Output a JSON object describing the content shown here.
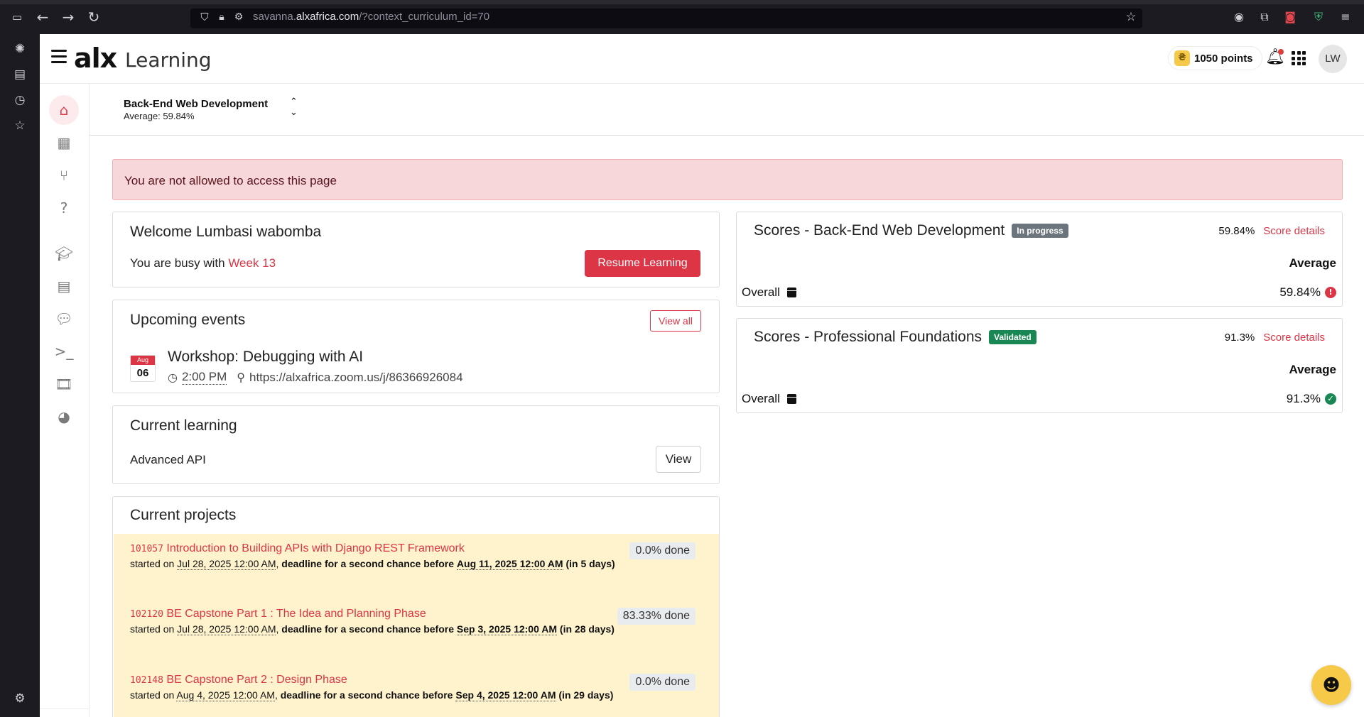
{
  "browser": {
    "url_prefix": "savanna.",
    "url_domain": "alxafrica.com",
    "url_path": "/?context_curriculum_id=70"
  },
  "header": {
    "logo": "alx",
    "product": "Learning",
    "points": "1050 points",
    "avatar_initials": "LW"
  },
  "curriculum": {
    "title": "Back-End Web Development",
    "average": "Average: 59.84%"
  },
  "alert": "You are not allowed to access this page",
  "welcome": {
    "title": "Welcome Lumbasi wabomba",
    "busy_prefix": "You are busy with",
    "busy_week": "Week 13",
    "resume_label": "Resume Learning"
  },
  "events": {
    "title": "Upcoming events",
    "view_all": "View all",
    "items": [
      {
        "month": "Aug",
        "day": "06",
        "name": "Workshop: Debugging with AI",
        "time": "2:00 PM",
        "location": "https://alxafrica.zoom.us/j/86366926084"
      }
    ]
  },
  "current_learning": {
    "title": "Current learning",
    "item": "Advanced API",
    "view_label": "View"
  },
  "projects": {
    "title": "Current projects",
    "items": [
      {
        "id": "101057",
        "name": "Introduction to Building APIs with Django REST Framework",
        "started_label": "started on",
        "started": "Jul 28, 2025 12:00 AM",
        "deadline_label": "deadline for a second chance before",
        "deadline": "Aug 11, 2025 12:00 AM",
        "remaining": "(in 5 days)",
        "done": "0.0% done"
      },
      {
        "id": "102120",
        "name": "BE Capstone Part 1 : The Idea and Planning Phase",
        "started_label": "started on",
        "started": "Jul 28, 2025 12:00 AM",
        "deadline_label": "deadline for a second chance before",
        "deadline": "Sep 3, 2025 12:00 AM",
        "remaining": "(in 28 days)",
        "done": "83.33% done"
      },
      {
        "id": "102148",
        "name": "BE Capstone Part 2 : Design Phase",
        "started_label": "started on",
        "started": "Aug 4, 2025 12:00 AM",
        "deadline_label": "deadline for a second chance before",
        "deadline": "Sep 4, 2025 12:00 AM",
        "remaining": "(in 29 days)",
        "done": "0.0% done"
      }
    ]
  },
  "scores": [
    {
      "title": "Scores - Back-End Web Development",
      "badge": "In progress",
      "percent": "59.84%",
      "details_label": "Score details",
      "avg_label": "Average",
      "overall_label": "Overall",
      "overall_value": "59.84%",
      "status": "!"
    },
    {
      "title": "Scores - Professional Foundations",
      "badge": "Validated",
      "percent": "91.3%",
      "details_label": "Score details",
      "avg_label": "Average",
      "overall_label": "Overall",
      "overall_value": "91.3%",
      "status": "✓"
    }
  ],
  "icons": {
    "sidebar_toggle": "sidebar-toggle-icon",
    "back": "back-arrow-icon",
    "forward": "forward-arrow-icon",
    "reload": "reload-icon",
    "shield": "shield-icon",
    "lock": "lock-icon",
    "star": "bookmark-star-icon"
  },
  "colors": {
    "accent": "#dc3545",
    "alert_bg": "#f8d7da",
    "project_bg": "#fff3cd",
    "badge_progress": "#6c757d",
    "badge_validated": "#198754",
    "points": "#f7c948"
  }
}
